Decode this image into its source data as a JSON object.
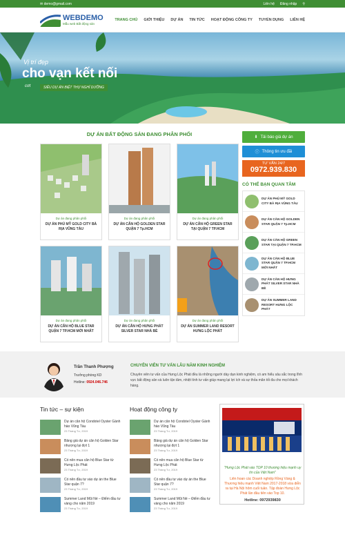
{
  "topbar": {
    "email": "demo@gmail.com",
    "register": "Liên hệ",
    "login": "Đăng nhập"
  },
  "logo": {
    "name": "WEBDEMO",
    "tagline": "Mẫu web Bất động sản"
  },
  "nav": [
    "TRANG CHỦ",
    "GIỚI THIỆU",
    "DỰ ÁN",
    "TIN TỨC",
    "HOẠT ĐỘNG CÔNG TY",
    "TUYỂN DỤNG",
    "LIÊN HỆ"
  ],
  "hero": {
    "line1": "Vị trí đẹp",
    "line2": "cho vạn kết nối",
    "line3_prefix": "cơt",
    "line3": "SIÊU DỰ ÁN BIỆT THỰ NGHỈ DƯỠNG"
  },
  "projects": {
    "title": "DỰ ÁN BẤT ĐỘNG SẢN ĐANG PHÂN PHỐI",
    "items": [
      {
        "status": "Dự án đang phân phối",
        "name": "DỰ ÁN PHÚ MỸ GOLD CITY BÀ RỊA VŨNG TÀU"
      },
      {
        "status": "Dự án đang phân phối",
        "name": "DỰ ÁN CĂN HỘ GOLDEN STAR QUẬN 7 Tp.HCM"
      },
      {
        "status": "Dự án đang phân phối",
        "name": "DỰ ÁN CĂN HỘ GREEN STAR TẠI QUẬN 7 TP.HCM"
      },
      {
        "status": "Dự án đang phân phối",
        "name": "DỰ ÁN CĂN HỘ BLUE STAR QUẬN 7 TP.HCM MỚI NHẤT"
      },
      {
        "status": "Dự án đang phân phối",
        "name": "DỰ ÁN CĂN HỘ HƯNG PHÁT SILVER STAR NHÀ BÈ"
      },
      {
        "status": "Dự án đang phân phối",
        "name": "DỰ ÁN SUMMER LAND RESORT HƯNG LỘC PHÁT"
      }
    ]
  },
  "sidebar": {
    "price_btn": "Tải báo giá dự án",
    "offer_btn": "Thông tin ưu đãi",
    "hotline_label": "TƯ VẤN 24/7",
    "hotline": "0972.939.830",
    "interest_title": "CÓ THỂ BẠN QUAN TÂM",
    "interest": [
      "DỰ ÁN PHÚ MỸ GOLD CITY BÀ RỊA VŨNG TÀU",
      "DỰ ÁN CĂN HỘ GOLDEN STAR QUẬN 7 Tp.HCM",
      "DỰ ÁN CĂN HỘ GREEN STAR TẠI QUẬN 7 TP.HCM",
      "DỰ ÁN CĂN HỘ BLUE STAR QUẬN 7 TP.HCM MỚI NHẤT",
      "DỰ ÁN CĂN HỘ HƯNG PHÁT SILVER STAR NHÀ BÈ",
      "DỰ ÁN SUMMER LAND RESORT HƯNG LỘC PHÁT"
    ]
  },
  "consultant": {
    "name": "Trần Thanh Phượng",
    "role": "Trưởng phòng KD",
    "hotline_label": "Hotline:",
    "hotline": "0924.046.746",
    "title": "CHUYÊN VIÊN TƯ VẤN LÂU NĂM KINH NGHIỆM",
    "desc": "Chuyên viên tư vấn của Hưng Lộc Phát đều là những người dày dạn kinh nghiệm, có am hiểu sâu sắc trong lĩnh vực bất động sản và luôn tận tâm, nhiệt tình tư vấn giúp mang lại lợi ích và sự thỏa mãn tối đa cho mọi khách hàng."
  },
  "news": {
    "title": "Tin tức – sự kiện",
    "items": [
      {
        "title": "Dự án căn hộ Condotel Oyster Gành hào Vũng Tàu",
        "date": "23 Tháng Tư, 2019"
      },
      {
        "title": "Bảng giá dự án căn hộ Golden Star nhượng lại đợt 1",
        "date": "23 Tháng Tư, 2019"
      },
      {
        "title": "Có nên mua căn hộ Blue Star từ Hưng Lộc Phát",
        "date": "23 Tháng Tư, 2019"
      },
      {
        "title": "Có nên đầu tư vào dự án the Blue Star quận 7?",
        "date": "23 Tháng Tư, 2019"
      },
      {
        "title": "Summer Land Mũi Né – Điểm đầu tư vàng cho năm 2019",
        "date": "23 Tháng Tư, 2019"
      }
    ]
  },
  "activity": {
    "title": "Hoạt động công ty",
    "items": [
      {
        "title": "Dự án căn hộ Condotel Oyster Gành hào Vũng Tàu",
        "date": "23 Tháng Tư, 2019"
      },
      {
        "title": "Bảng giá dự án căn hộ Golden Star nhượng lại đợt 1",
        "date": "23 Tháng Tư, 2019"
      },
      {
        "title": "Có nên mua căn hộ Blue Star từ Hưng Lộc Phát",
        "date": "23 Tháng Tư, 2019"
      },
      {
        "title": "Có nên đầu tư vào dự án the Blue Star quận 7?",
        "date": "23 Tháng Tư, 2019"
      },
      {
        "title": "Summer Land Mũi Né – Điểm đầu tư vàng cho năm 2019",
        "date": "23 Tháng Tư, 2019"
      }
    ]
  },
  "award": {
    "quote": "\"Hưng Lộc Phát vào TOP 10 thương hiệu mạnh uy tín của Việt Nam\"",
    "para": "Liên hoan các Doanh nghiệp Rồng Vàng & Thương hiệu mạnh Việt Nam 2017-2018 vừa diễn ra tại Hà Nội hôm cuối tuần. Tập đoàn Hưng Lộc Phát lần đầu tiên vào Top 10.",
    "hotline": "Hotline: 0972939830"
  },
  "colors": {
    "brand_green": "#3f8e34",
    "orange": "#e8651f",
    "blue": "#1f8fd6"
  }
}
